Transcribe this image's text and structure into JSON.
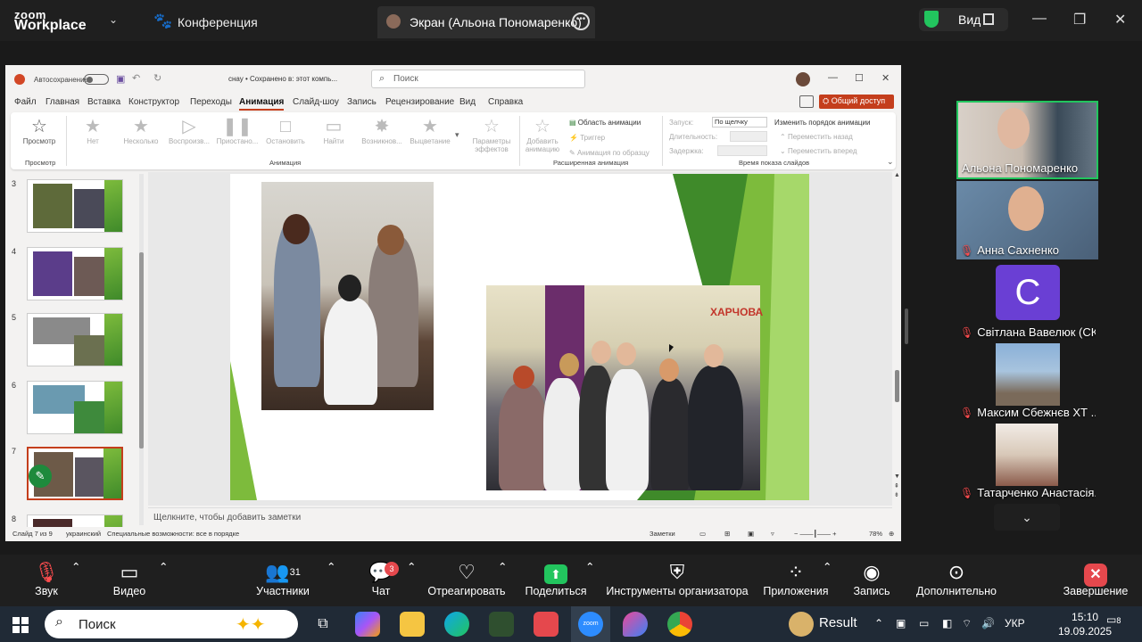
{
  "zoom": {
    "brand_line1": "zoom",
    "brand_line2": "Workplace",
    "conference_label": "Конференция",
    "screen_tab_label": "Экран (Альона Пономаренко)",
    "view_label": "Вид"
  },
  "ppt": {
    "autosave_label": "Автосохранение",
    "doc_name": "снау • Сохранено в: этот компь...",
    "search_placeholder": "Поиск",
    "share_label": "Общий доступ",
    "menu": [
      "Файл",
      "Главная",
      "Вставка",
      "Конструктор",
      "Переходы",
      "Анимация",
      "Слайд-шоу",
      "Запись",
      "Рецензирование",
      "Вид",
      "Справка"
    ],
    "active_menu": "Анимация",
    "ribbon": {
      "preview_label": "Просмотр",
      "preview_group": "Просмотр",
      "animations": [
        "Нет",
        "Несколько",
        "Воспроизв...",
        "Приостано...",
        "Остановить",
        "Найти",
        "Возникнов...",
        "Выцветание"
      ],
      "effects_label": "Параметры эффектов",
      "animation_group": "Анимация",
      "add_animation": "Добавить анимацию",
      "anim_pane": "Область анимации",
      "trigger": "Триггер",
      "anim_painter": "Анимация по образцу",
      "advanced_group": "Расширенная анимация",
      "start_label": "Запуск:",
      "start_value": "По щелчку",
      "duration_label": "Длительность:",
      "delay_label": "Задержка:",
      "reorder_label": "Изменить порядок анимации",
      "move_back": "Переместить назад",
      "move_forward": "Переместить вперед",
      "timing_group": "Время показа слайдов"
    },
    "thumb_numbers": [
      "3",
      "4",
      "5",
      "6",
      "7",
      "8"
    ],
    "slide_sign": "ХАРЧОВА",
    "notes_placeholder": "Щелкните, чтобы добавить заметки",
    "status": {
      "slide_info": "Слайд 7 из 9",
      "language": "украинский",
      "accessibility": "Специальные возможности: все в порядке",
      "notes_btn": "Заметки",
      "zoom_pct": "78%"
    }
  },
  "participants": [
    {
      "name": "Альона Пономаренко",
      "muted": false
    },
    {
      "name": "Анна Сахненко",
      "muted": true
    },
    {
      "name": "Світлана Вавелюк (СК)",
      "muted": true,
      "initial": "C"
    },
    {
      "name": "Максим Сбежнєв ХТ ...",
      "muted": true
    },
    {
      "name": "Татарченко Анастасія...",
      "muted": true
    }
  ],
  "toolbar": {
    "audio": "Звук",
    "video": "Видео",
    "participants": "Участники",
    "participants_count": "31",
    "chat": "Чат",
    "chat_badge": "3",
    "react": "Отреагировать",
    "share": "Поделиться",
    "host_tools": "Инструменты организатора",
    "apps": "Приложения",
    "record": "Запись",
    "more": "Дополнительно",
    "end": "Завершение"
  },
  "taskbar": {
    "search": "Поиск",
    "result_label": "Result",
    "lang": "УКР",
    "time": "15:10",
    "date": "19.09.2025",
    "notifications": "8"
  },
  "colors": {
    "accent_green": "#22c55e",
    "ppt_accent": "#c43e1c",
    "slide_green": "#7dbb3c"
  }
}
